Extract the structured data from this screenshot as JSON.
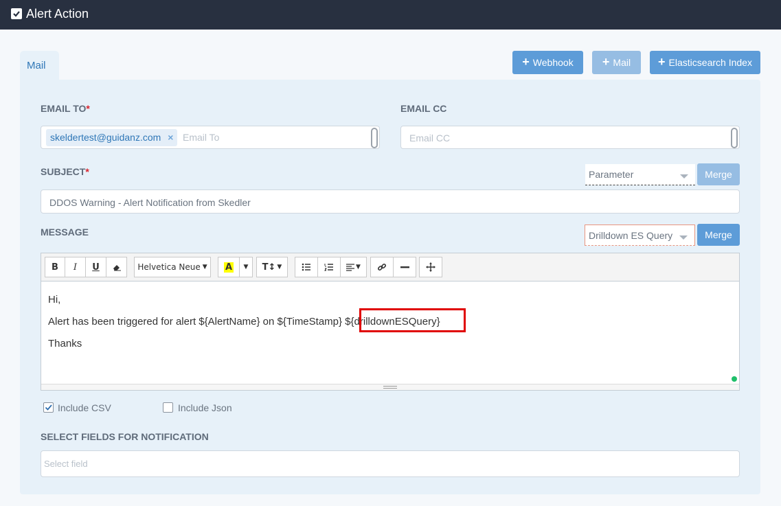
{
  "header": {
    "title": "Alert Action",
    "checked": true
  },
  "tabs": [
    {
      "label": "Mail",
      "active": true
    }
  ],
  "actions": {
    "webhook": "Webhook",
    "mail": "Mail",
    "elasticsearch": "Elasticsearch Index"
  },
  "form": {
    "email_to": {
      "label": "EMAIL TO",
      "required_mark": "*",
      "tag": "skeldertest@guidanz.com",
      "tag_remove": "×",
      "placeholder": "Email To"
    },
    "email_cc": {
      "label": "EMAIL CC",
      "placeholder": "Email CC"
    },
    "subject": {
      "label": "SUBJECT",
      "required_mark": "*",
      "parameter_select": "Parameter",
      "merge_label": "Merge",
      "value": "DDOS Warning - Alert Notification from Skedler"
    },
    "message": {
      "label": "MESSAGE",
      "query_select": "Drilldown ES Query",
      "merge_label": "Merge",
      "toolbar": {
        "bold": "B",
        "italic": "I",
        "underline": "U",
        "font": "Helvetica Neue",
        "color": "A",
        "size": "T↕"
      },
      "lines": [
        "Hi,",
        "Alert has been triggered for alert ${AlertName} on ${TimeStamp} ${drilldownESQuery}",
        "Thanks"
      ]
    },
    "include_csv": {
      "label": "Include CSV",
      "checked": true
    },
    "include_json": {
      "label": "Include Json",
      "checked": false
    },
    "fields": {
      "label": "SELECT FIELDS FOR NOTIFICATION",
      "placeholder": "Select field"
    }
  },
  "colors": {
    "header_bg": "#283040",
    "accent": "#5d9cd8",
    "highlight": "#e00000"
  }
}
